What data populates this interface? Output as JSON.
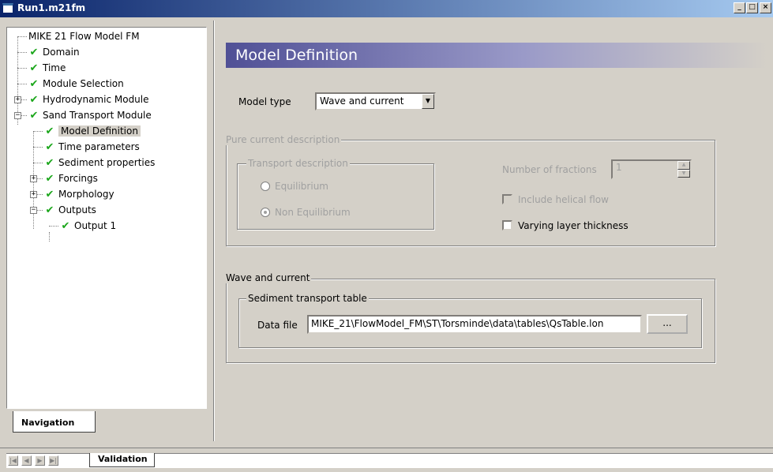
{
  "window": {
    "title": "Run1.m21fm",
    "min_label": "_",
    "max_label": "□",
    "close_label": "×"
  },
  "tree": {
    "items": [
      {
        "label": "MIKE 21 Flow Model FM",
        "checked": false
      },
      {
        "label": "Domain",
        "checked": true
      },
      {
        "label": "Time",
        "checked": true
      },
      {
        "label": "Module Selection",
        "checked": true
      },
      {
        "label": "Hydrodynamic Module",
        "checked": true,
        "expander": "+"
      },
      {
        "label": "Sand Transport Module",
        "checked": true,
        "expander": "−"
      },
      {
        "label": "Model Definition",
        "checked": true,
        "selected": true
      },
      {
        "label": "Time parameters",
        "checked": true
      },
      {
        "label": "Sediment properties",
        "checked": true
      },
      {
        "label": "Forcings",
        "checked": true,
        "expander": "+"
      },
      {
        "label": "Morphology",
        "checked": true,
        "expander": "+"
      },
      {
        "label": "Outputs",
        "checked": true,
        "expander": "−"
      },
      {
        "label": "Output 1",
        "checked": true
      }
    ],
    "check_glyph": "✔"
  },
  "navigation_tab": "Navigation",
  "page": {
    "title": "Model Definition",
    "model_type_label": "Model type",
    "model_type_value": "Wave and current",
    "pure_current": {
      "legend": "Pure current description",
      "transport_legend": "Transport description",
      "equilibrium": "Equilibrium",
      "non_equilibrium": "Non Equilibrium",
      "fractions_label": "Number of fractions",
      "fractions_value": "1",
      "helical_label": "Include helical flow",
      "varying_label": "Varying layer thickness"
    },
    "wave_current": {
      "legend": "Wave and current",
      "table_legend": "Sediment transport table",
      "data_file_label": "Data file",
      "data_file_value": "MIKE_21\\FlowModel_FM\\ST\\Torsminde\\data\\tables\\QsTable.lon",
      "browse_label": "..."
    }
  },
  "bottom": {
    "validation_tab": "Validation"
  },
  "colors": {
    "check": "#1aa61a",
    "title_bar": "#0a246a",
    "banner": "#505096"
  }
}
